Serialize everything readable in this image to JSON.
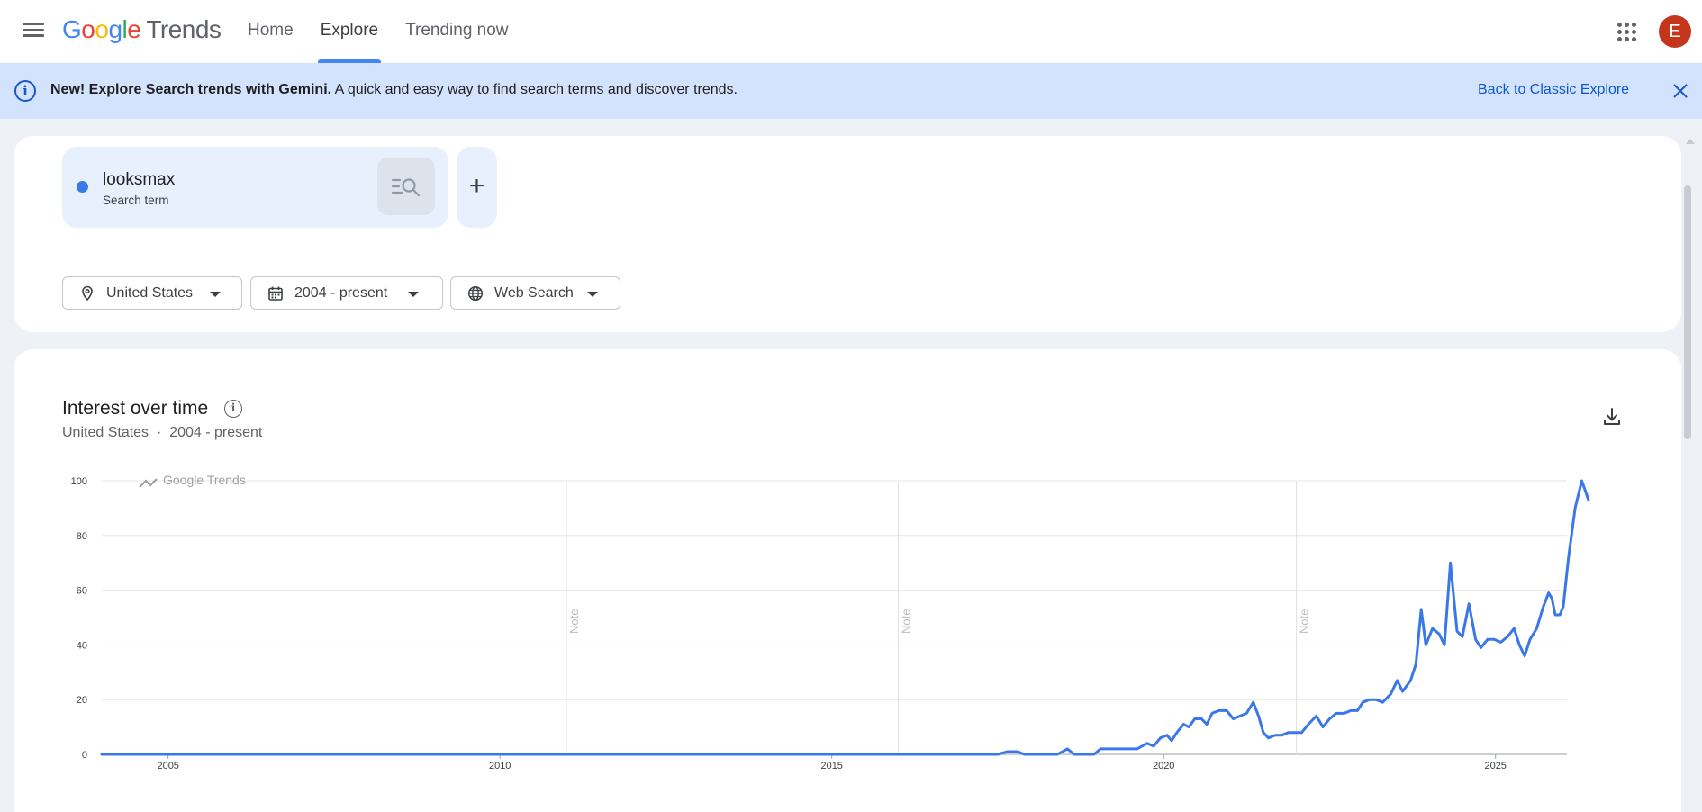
{
  "header": {
    "logo_google": "Google",
    "logo_trends": "Trends",
    "nav": [
      {
        "label": "Home"
      },
      {
        "label": "Explore"
      },
      {
        "label": "Trending now"
      }
    ],
    "avatar_letter": "E"
  },
  "banner": {
    "bold_text": "New! Explore Search trends with Gemini.",
    "text": " A quick and easy way to find search terms and discover trends.",
    "link": "Back to Classic Explore"
  },
  "search": {
    "term": "looksmax",
    "term_type": "Search term",
    "term_color": "#3b78e7"
  },
  "filters": {
    "location": "United States",
    "time_range": "2004 - present",
    "property": "Web Search"
  },
  "interest_over_time": {
    "title": "Interest over time",
    "subtitle_location": "United States",
    "subtitle_separator": "·",
    "subtitle_time": "2004 - present",
    "watermark": "Google Trends"
  },
  "chart_data": {
    "type": "line",
    "title": "Interest over time",
    "xlabel": "",
    "ylabel": "",
    "xlim": [
      2004.0,
      2026.1
    ],
    "ylim": [
      0,
      100
    ],
    "y_ticks": [
      0,
      20,
      40,
      60,
      80,
      100
    ],
    "x_ticks": [
      2005,
      2010,
      2015,
      2020,
      2025
    ],
    "notes": [
      {
        "x": 2011.0,
        "label": "Note"
      },
      {
        "x": 2016.0,
        "label": "Note"
      },
      {
        "x": 2022.0,
        "label": "Note"
      }
    ],
    "grid": true,
    "series": [
      {
        "name": "looksmax",
        "color": "#3b78e7",
        "points": [
          [
            2004.0,
            0
          ],
          [
            2017.5,
            0
          ],
          [
            2017.65,
            1
          ],
          [
            2017.8,
            1
          ],
          [
            2017.9,
            0
          ],
          [
            2018.4,
            0
          ],
          [
            2018.55,
            2
          ],
          [
            2018.65,
            0
          ],
          [
            2018.95,
            0
          ],
          [
            2019.05,
            2
          ],
          [
            2019.6,
            2
          ],
          [
            2019.75,
            4
          ],
          [
            2019.85,
            3
          ],
          [
            2019.95,
            6
          ],
          [
            2020.05,
            7
          ],
          [
            2020.12,
            5
          ],
          [
            2020.2,
            8
          ],
          [
            2020.3,
            11
          ],
          [
            2020.38,
            10
          ],
          [
            2020.47,
            13
          ],
          [
            2020.57,
            13
          ],
          [
            2020.65,
            11
          ],
          [
            2020.73,
            15
          ],
          [
            2020.83,
            16
          ],
          [
            2020.95,
            16
          ],
          [
            2021.05,
            13
          ],
          [
            2021.15,
            14
          ],
          [
            2021.25,
            15
          ],
          [
            2021.35,
            19
          ],
          [
            2021.43,
            14
          ],
          [
            2021.5,
            8
          ],
          [
            2021.58,
            6
          ],
          [
            2021.68,
            7
          ],
          [
            2021.78,
            7
          ],
          [
            2021.88,
            8
          ],
          [
            2021.98,
            8
          ],
          [
            2022.08,
            8
          ],
          [
            2022.18,
            11
          ],
          [
            2022.3,
            14
          ],
          [
            2022.4,
            10
          ],
          [
            2022.5,
            13
          ],
          [
            2022.6,
            15
          ],
          [
            2022.72,
            15
          ],
          [
            2022.82,
            16
          ],
          [
            2022.92,
            16
          ],
          [
            2023.0,
            19
          ],
          [
            2023.1,
            20
          ],
          [
            2023.2,
            20
          ],
          [
            2023.3,
            19
          ],
          [
            2023.42,
            22
          ],
          [
            2023.52,
            27
          ],
          [
            2023.6,
            23
          ],
          [
            2023.72,
            27
          ],
          [
            2023.8,
            33
          ],
          [
            2023.88,
            53
          ],
          [
            2023.95,
            40
          ],
          [
            2024.05,
            46
          ],
          [
            2024.15,
            44
          ],
          [
            2024.23,
            40
          ],
          [
            2024.32,
            70
          ],
          [
            2024.42,
            45
          ],
          [
            2024.5,
            43
          ],
          [
            2024.6,
            55
          ],
          [
            2024.7,
            42
          ],
          [
            2024.78,
            39
          ],
          [
            2024.88,
            42
          ],
          [
            2024.98,
            42
          ],
          [
            2025.08,
            41
          ],
          [
            2025.18,
            43
          ],
          [
            2025.28,
            46
          ],
          [
            2025.36,
            40
          ],
          [
            2025.44,
            36
          ],
          [
            2025.52,
            42
          ],
          [
            2025.62,
            46
          ],
          [
            2025.72,
            54
          ],
          [
            2025.8,
            59
          ],
          [
            2025.85,
            57
          ],
          [
            2025.9,
            51
          ],
          [
            2025.97,
            51
          ],
          [
            2026.02,
            54
          ],
          [
            2026.1,
            72
          ],
          [
            2026.2,
            90
          ],
          [
            2026.3,
            100
          ],
          [
            2026.4,
            93
          ]
        ]
      }
    ]
  },
  "icons": {
    "menu": "menu-icon",
    "apps": "apps-grid-icon",
    "info": "info-icon",
    "close": "close-icon",
    "location": "location-pin-icon",
    "calendar": "calendar-icon",
    "globe": "globe-icon",
    "download": "download-icon",
    "search_compare": "search-list-icon",
    "add": "plus-icon"
  }
}
